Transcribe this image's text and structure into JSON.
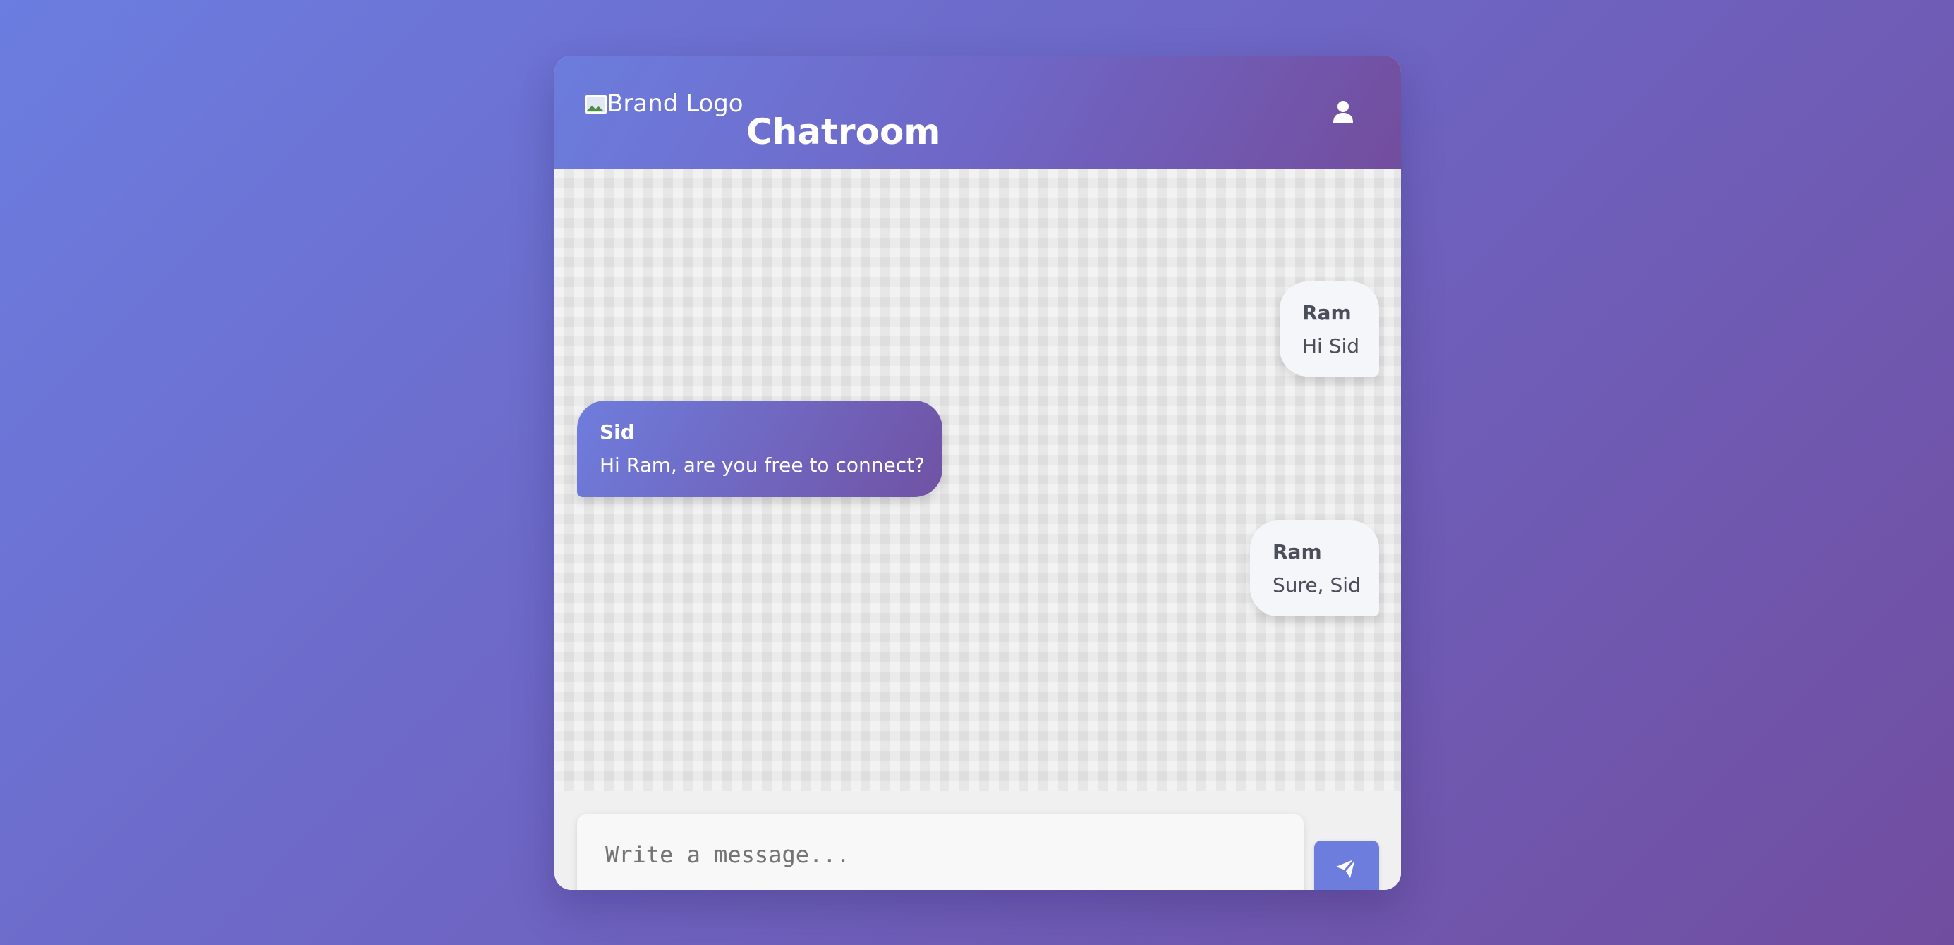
{
  "app": {
    "title": "Chatroom",
    "logo_alt": "Brand Logo",
    "header_icon": "user-icon"
  },
  "messages": [
    {
      "sender": "Ram",
      "text": "Hi Sid",
      "direction": "outgoing"
    },
    {
      "sender": "Sid",
      "text": "Hi Ram, are you free to connect?",
      "direction": "incoming"
    },
    {
      "sender": "Ram",
      "text": "Sure, Sid",
      "direction": "outgoing"
    }
  ],
  "composer": {
    "placeholder": "Write a message...",
    "value": "",
    "send_icon": "paper-plane-icon"
  },
  "colors": {
    "background_start": "#6b7de0",
    "background_end": "#714d9f",
    "accent": "#6c7ddd",
    "outgoing_bubble": "#f5f6f9",
    "incoming_bubble_start": "#6f7ddd",
    "incoming_bubble_end": "#7052a4"
  }
}
